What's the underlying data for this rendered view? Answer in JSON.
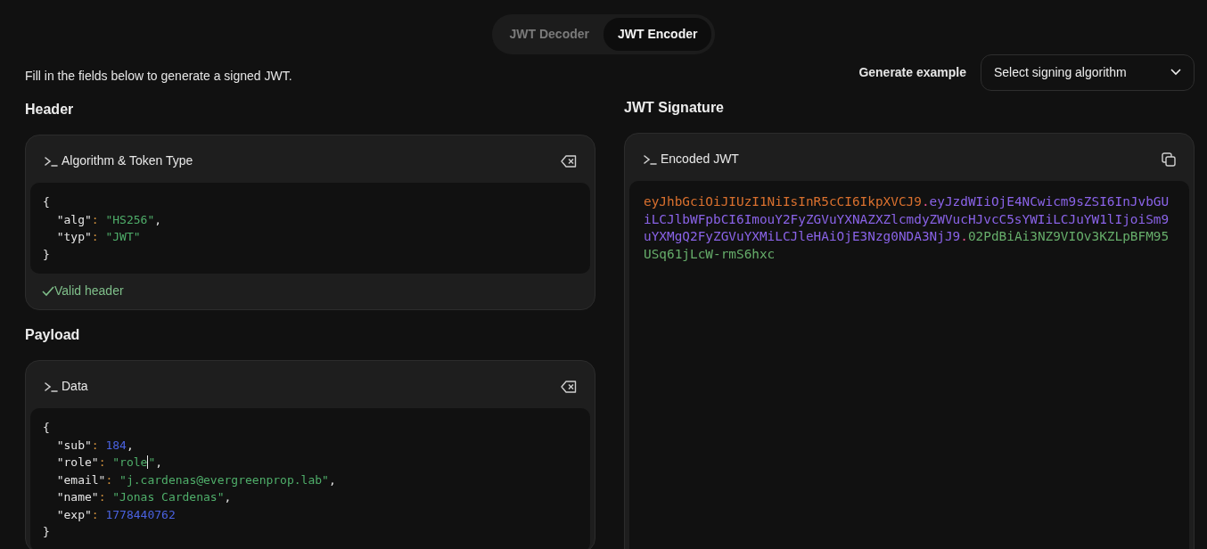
{
  "tabs": [
    {
      "label": "JWT Decoder",
      "selected": false
    },
    {
      "label": "JWT Encoder",
      "selected": true
    }
  ],
  "intro": "Fill in the fields below to generate a signed JWT.",
  "generate_example": {
    "label": "Generate example",
    "select": "Select signing algorithm"
  },
  "header_section": {
    "heading": "Header",
    "panel_title": "Algorithm & Token Type",
    "lines": [
      [
        {
          "kind": "punct",
          "text": "{"
        }
      ],
      [
        {
          "kind": "key",
          "text": "\"alg\""
        },
        {
          "kind": "colon",
          "text": ": "
        },
        {
          "kind": "string",
          "text": "\"HS256\""
        },
        {
          "kind": "punct",
          "text": ","
        }
      ],
      [
        {
          "kind": "key",
          "text": "\"typ\""
        },
        {
          "kind": "colon",
          "text": ": "
        },
        {
          "kind": "string",
          "text": "\"JWT\""
        }
      ],
      [
        {
          "kind": "punct",
          "text": "}"
        }
      ]
    ],
    "status": {
      "text": "Valid header",
      "valid": true
    }
  },
  "payload_section": {
    "heading": "Payload",
    "panel_title": "Data",
    "lines": [
      [
        {
          "kind": "punct",
          "text": "{"
        }
      ],
      [
        {
          "kind": "key",
          "text": "\"sub\""
        },
        {
          "kind": "colon",
          "text": ": "
        },
        {
          "kind": "number",
          "text": "184"
        },
        {
          "kind": "punct",
          "text": ","
        }
      ],
      [
        {
          "kind": "key",
          "text": "\"role\""
        },
        {
          "kind": "colon",
          "text": ": "
        },
        {
          "kind": "string",
          "text": "\"role"
        },
        {
          "kind": "caret"
        },
        {
          "kind": "string",
          "text": "\""
        },
        {
          "kind": "punct",
          "text": ","
        }
      ],
      [
        {
          "kind": "key",
          "text": "\"email\""
        },
        {
          "kind": "colon",
          "text": ": "
        },
        {
          "kind": "string",
          "text": "\"j.cardenas@evergreenprop.lab\""
        },
        {
          "kind": "punct",
          "text": ","
        }
      ],
      [
        {
          "kind": "key",
          "text": "\"name\""
        },
        {
          "kind": "colon",
          "text": ": "
        },
        {
          "kind": "string",
          "text": "\"Jonas Cardenas\""
        },
        {
          "kind": "punct",
          "text": ","
        }
      ],
      [
        {
          "kind": "key",
          "text": "\"exp\""
        },
        {
          "kind": "colon",
          "text": ": "
        },
        {
          "kind": "number",
          "text": "1778440762"
        }
      ],
      [
        {
          "kind": "punct",
          "text": "}"
        }
      ]
    ]
  },
  "signature_section": {
    "heading": "JWT Signature",
    "panel_title": "Encoded JWT",
    "token": [
      {
        "kind": "header",
        "text": "eyJhbGciOiJIUzI1NiIsInR5cCI6IkpXVCJ9"
      },
      {
        "kind": "dot",
        "text": "."
      },
      {
        "kind": "payload",
        "text": "eyJzdWIiOjE4NCwicm9sZSI6InJvbGUiLCJlbWFpbCI6ImouY2FyZGVuYXNAZXZlcmdyZWVucHJvcC5sYWIiLCJuYW1lIjoiSm9uYXMgQ2FyZGVuYXMiLCJleHAiOjE3Nzg0NDA3NjJ9"
      },
      {
        "kind": "dot",
        "text": "."
      },
      {
        "kind": "signature",
        "text": "02PdBiAi3NZ9VIOv3KZLpBFM95USq61jLcW-rmS6hxc"
      }
    ]
  }
}
